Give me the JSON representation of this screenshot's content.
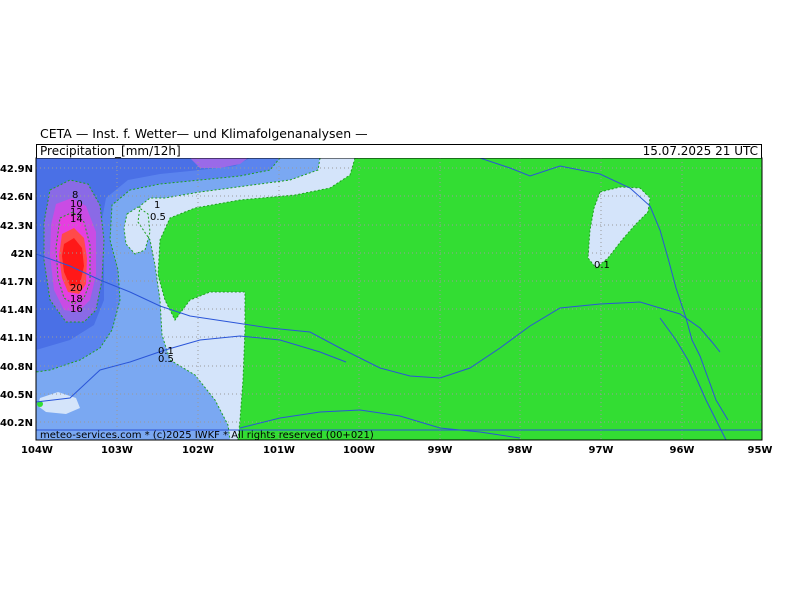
{
  "title": "CETA — Inst. f. Wetter— und Klimafolgenanalysen —",
  "header": {
    "parameter": "Precipitation_[mm/12h]",
    "datetime": "15.07.2025  21  UTC"
  },
  "footer": "meteo-services.com * (c)2025 IWKF * All rights reserved (00+021)",
  "map": {
    "lon_labels": [
      "104W",
      "103W",
      "102W",
      "101W",
      "100W",
      "99W",
      "98W",
      "97W",
      "96W",
      "95W"
    ],
    "lat_labels": [
      "42.9N",
      "42.6N",
      "42.3N",
      "42N",
      "41.7N",
      "41.4N",
      "41.1N",
      "40.8N",
      "40.5N",
      "40.2N"
    ],
    "contour_labels": [
      "8",
      "10",
      "12",
      "14",
      "1",
      "0.5",
      "20",
      "18",
      "16",
      "0.1",
      "0.1",
      "0.5"
    ]
  },
  "colors": {
    "land_green": "#33dd33",
    "light_blue": "#d4e4fa",
    "mid_blue": "#7aa8f2",
    "blue": "#5b84ee",
    "violet": "#a060e8",
    "magenta": "#e040e0",
    "red": "#ff2020",
    "border_line": "#2a55d8",
    "contour_dash": "#1fa01f"
  }
}
